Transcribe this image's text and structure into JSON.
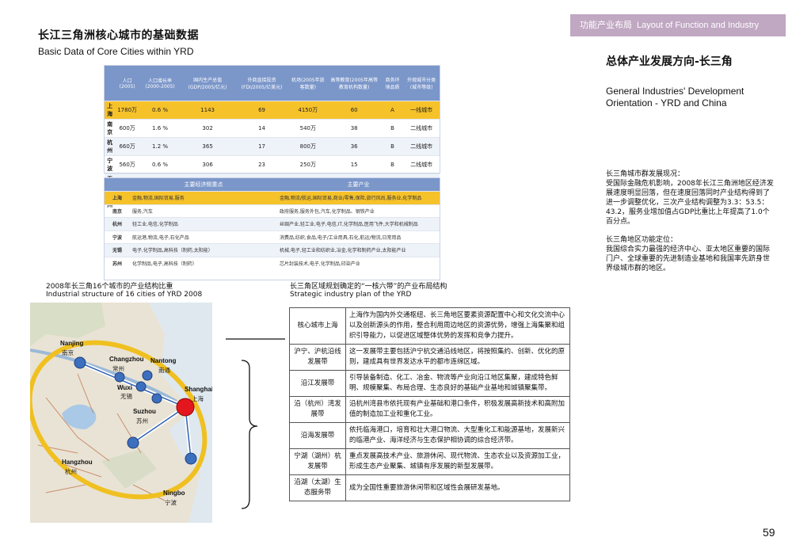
{
  "header": {
    "title_cn": "长江三角洲核心城市的基础数据",
    "title_en": "Basic Data of Core Cities within YRD",
    "tab_cn": "功能产业布局",
    "tab_en": "Layout of Function and Industry"
  },
  "right": {
    "title": "总体产业发展方向-长三角",
    "subtitle": "General Industries' Development Orientation - YRD and China",
    "para1_head": "长三角城市群发展现况：",
    "para1": "受国际金融危机影响，2008年长江三角洲地区经济发展速度明显回落，但在速度回落同时产业结构得到了进一步调整优化，三次产业结构调整为3.3：53.5：43.2，服务业增加值占GDP比重比上年提高了1.0个百分点。",
    "para2_head": "长三角地区功能定位：",
    "para2": "我国综合实力最强的经济中心、亚太地区重要的国际门户、全球重要的先进制造业基地和我国率先跻身世界级城市群的地区。"
  },
  "table1": {
    "headers": [
      "",
      "人口(2005)",
      "人口增长率(2000-2005)",
      "国内生产总值(GDP/2005/亿元)",
      "外商直接投资(FDI/2005/亿美元)",
      "机场(2005年旅客数量)",
      "高等教育(2005年高等教育机构数量)",
      "商务环境品质",
      "外观城市分类(城市等级)"
    ],
    "rows": [
      [
        "上海",
        "1780万",
        "0.6 %",
        "1143",
        "69",
        "4150万",
        "60",
        "A",
        "一线城市"
      ],
      [
        "南京",
        "600万",
        "1.6 %",
        "302",
        "14",
        "540万",
        "38",
        "B",
        "二线城市"
      ],
      [
        "杭州",
        "660万",
        "1.2 %",
        "365",
        "17",
        "800万",
        "36",
        "B",
        "二线城市"
      ],
      [
        "宁波",
        "560万",
        "0.6 %",
        "306",
        "23",
        "250万",
        "15",
        "B",
        "二线城市"
      ],
      [
        "无锡",
        "450万",
        "0.8 %",
        "351",
        "25",
        "60万",
        "9",
        "C",
        "三线城市"
      ],
      [
        "苏州",
        "610万",
        "1.0 %",
        "503",
        "60",
        "无",
        "13",
        "B",
        "二线城市"
      ]
    ]
  },
  "table2": {
    "headers": [
      "",
      "主要经济侧重点",
      "主要产业"
    ],
    "rows": [
      [
        "上海",
        "金融,物流,国际贸易,服务",
        "金融,物流/航运,国际贸易,商业/零售,保险,旅行风尚,服务业,化学制品"
      ],
      [
        "南京",
        "服务,汽车",
        "政府服务,服务外包,汽车,化学制品、钢铁产业"
      ],
      [
        "杭州",
        "轻工业,电信,化学制品",
        "丝绸产业,轻工业,电子,电信,IT,化学制品,医用飞件,大学和机械制品"
      ],
      [
        "宁波",
        "航运港,物流,电子,石化产品",
        "消费品,纺织,食品,电子/工业用具,石化,航运/物流,日常用品"
      ],
      [
        "无锡",
        "电子,化学制品,高科技（制药,太阳能）",
        "机械,电子,轻工业和纺织业,冶金,化学和制药产业,太阳能产业"
      ],
      [
        "苏州",
        "化学制品,电子,高科技（制药）",
        "芯片封装技术,电子,化学制品,印染产业"
      ]
    ]
  },
  "map": {
    "caption_cn": "2008年长三角16个城市的产业结构比重",
    "caption_en": "Industrial structure of 16 cities of YRD 2008",
    "cities": [
      {
        "en": "Nanjing",
        "cn": "南京"
      },
      {
        "en": "Changzhou",
        "cn": "常州"
      },
      {
        "en": "Nantong",
        "cn": "南通"
      },
      {
        "en": "Wuxi",
        "cn": "无锡"
      },
      {
        "en": "Shanghai",
        "cn": "上海"
      },
      {
        "en": "Suzhou",
        "cn": "苏州"
      },
      {
        "en": "Hangzhou",
        "cn": "杭州"
      },
      {
        "en": "Ningbo",
        "cn": "宁波"
      }
    ]
  },
  "plan": {
    "caption_cn": "长三角区域规划确定的“一核六带”的产业布局结构",
    "caption_en": "Strategic industry plan of the YRD",
    "core_label": "核心城市上海",
    "core_text": "上海作为国内外交通枢纽、长三角地区要素资源配置中心和文化交流中心以及创新源头的作用，整合利用周边地区的资源优势，增强上海集聚和组织引导能力，以促进区域整体优势的发挥和竞争力提升。",
    "rows": [
      {
        "label": "沪宁、沪杭沿线发展带",
        "text": "这一发展带主要包括沪宁杭交通沿线地区，将按照集约、创新、优化的原则，建成具有世界发达水平的都市连绵区域。"
      },
      {
        "label": "沿江发展带",
        "text": "引导装备制造、化工、冶金、物流等产业向沿江地区集聚，建成特色鲜明、规模聚集、布局合理、生态良好的基础产业基地和城镇聚集带。"
      },
      {
        "label": "沿（杭州）湾发展带",
        "text": "沿杭州湾县市依托现有产业基础和港口条件，积极发展高新技术和高附加值的制造加工业和重化工业。"
      },
      {
        "label": "沿海发展带",
        "text": "依托临海港口，培育和壮大港口物流、大型重化工和能源基地，发展新兴的临港产业、海洋经济与生态保护相协调的综合经济带。"
      },
      {
        "label": "宁湖（湖州）杭发展带",
        "text": "重点发展高技术产业、旅游休闲、现代物流、生态农业以及资源加工业，形成生态产业聚集、城镇有序发展的新型发展带。"
      },
      {
        "label": "沿湖（太湖）生态服务带",
        "text": "成为全国性重要旅游休闲带和区域性会展研发基地。"
      }
    ]
  },
  "page_number": "59",
  "colors": {
    "tab": "#c0a7c2",
    "table_header": "#7b96c9",
    "highlight": "#f6c22a",
    "accent_red": "#e3171d",
    "node_blue": "#3d6fbf"
  }
}
